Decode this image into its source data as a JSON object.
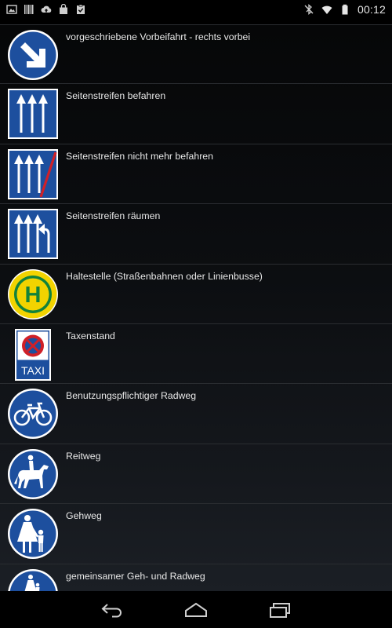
{
  "status_bar": {
    "time": "00:12",
    "left_icons": [
      "image-icon",
      "barcode-icon",
      "cloud-upload-icon",
      "shopping-bag-icon",
      "clipboard-check-icon"
    ],
    "right_icons": [
      "bluetooth-off-icon",
      "wifi-icon",
      "battery-icon"
    ]
  },
  "items": [
    {
      "label": "vorgeschriebene Vorbeifahrt - rechts vorbei",
      "sign": "keep-right-sign-icon"
    },
    {
      "label": "Seitenstreifen befahren",
      "sign": "use-hard-shoulder-sign-icon"
    },
    {
      "label": "Seitenstreifen nicht mehr befahren",
      "sign": "end-hard-shoulder-sign-icon"
    },
    {
      "label": "Seitenstreifen räumen",
      "sign": "clear-hard-shoulder-sign-icon"
    },
    {
      "label": "Haltestelle (Straßenbahnen oder Linienbusse)",
      "sign": "bus-stop-sign-icon",
      "sign_text": "H"
    },
    {
      "label": "Taxenstand",
      "sign": "taxi-stand-sign-icon",
      "sign_text": "TAXI"
    },
    {
      "label": "Benutzungspflichtiger Radweg",
      "sign": "bicycle-path-sign-icon"
    },
    {
      "label": "Reitweg",
      "sign": "bridle-path-sign-icon"
    },
    {
      "label": "Gehweg",
      "sign": "footpath-sign-icon"
    },
    {
      "label": "gemeinsamer Geh- und Radweg",
      "sign": "shared-foot-cycle-path-sign-icon"
    }
  ],
  "nav_bar": {
    "buttons": [
      "back-icon",
      "home-icon",
      "recent-apps-icon"
    ]
  },
  "colors": {
    "sign_blue": "#1d4f9e",
    "sign_red": "#d02027",
    "sign_yellow": "#f2d300",
    "sign_green": "#12823b",
    "text": "#e8e8e8",
    "divider": "#2a2d31"
  }
}
